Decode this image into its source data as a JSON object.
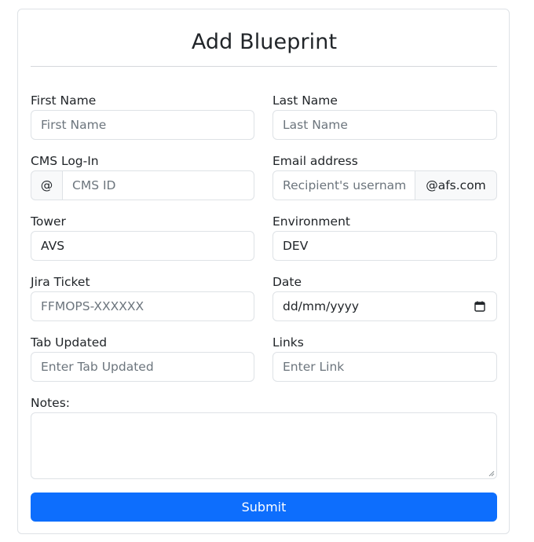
{
  "form": {
    "title": "Add Blueprint",
    "fields": {
      "first_name": {
        "label": "First Name",
        "placeholder": "First Name"
      },
      "last_name": {
        "label": "Last Name",
        "placeholder": "Last Name"
      },
      "cms_login": {
        "label": "CMS Log-In",
        "prefix": "@",
        "placeholder": "CMS ID"
      },
      "email": {
        "label": "Email address",
        "placeholder": "Recipient's usernam",
        "suffix": "@afs.com"
      },
      "tower": {
        "label": "Tower",
        "value": "AVS"
      },
      "environment": {
        "label": "Environment",
        "value": "DEV"
      },
      "jira": {
        "label": "Jira Ticket",
        "placeholder": "FFMOPS-XXXXXX"
      },
      "date": {
        "label": "Date",
        "value": "dd/mm/yyyy"
      },
      "tab_updated": {
        "label": "Tab Updated",
        "placeholder": "Enter Tab Updated"
      },
      "links": {
        "label": "Links",
        "placeholder": "Enter Link"
      },
      "notes": {
        "label": "Notes:",
        "value": ""
      }
    },
    "submit_label": "Submit"
  },
  "colors": {
    "primary": "#0d6efd",
    "border": "#dee2e6",
    "placeholder": "#6c757d",
    "addon_bg": "#f8f9fa"
  },
  "icons": {
    "date": "calendar-icon",
    "notes": "resize-grip-icon"
  }
}
